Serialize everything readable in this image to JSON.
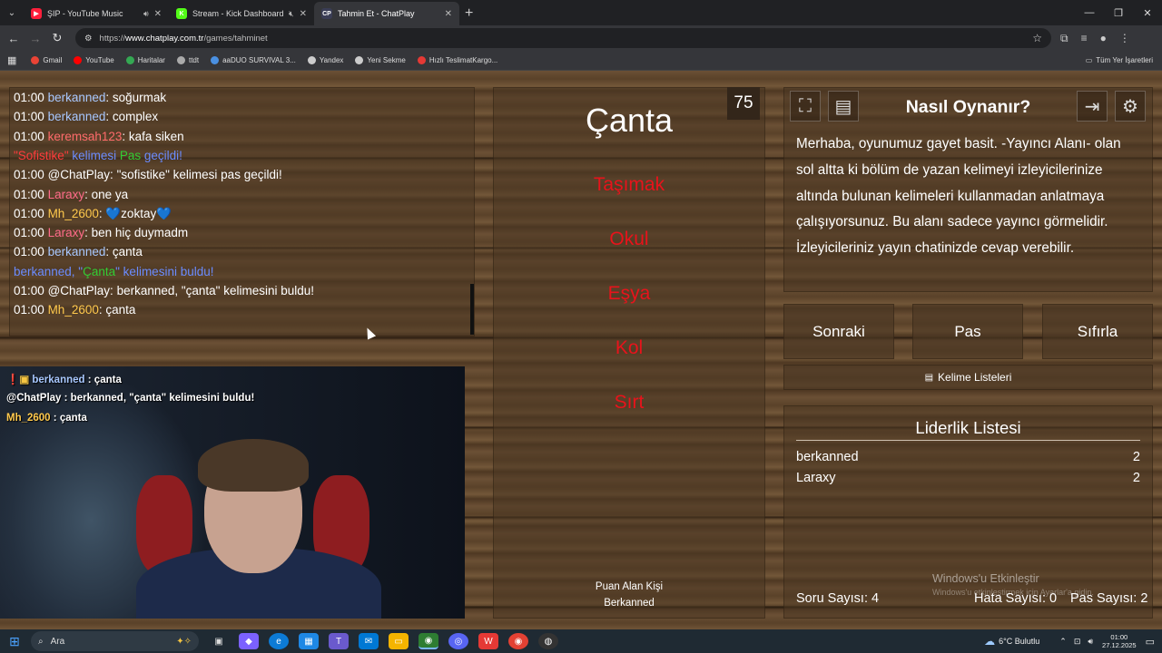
{
  "tabs": [
    {
      "title": "ŞIP - YouTube Music",
      "favicon_color": "#ff1f3b",
      "favicon_glyph": "▶",
      "audio": "speaker-icon"
    },
    {
      "title": "Stream - Kick Dashboard",
      "favicon_color": "#53fc18",
      "favicon_glyph": "K",
      "audio": "muted-speaker-icon"
    },
    {
      "title": "Tahmin Et - ChatPlay",
      "favicon_color": "#3a3d55",
      "favicon_glyph": "CP",
      "active": true
    }
  ],
  "address": {
    "prefix": "https://",
    "host": "www.chatplay.com.tr",
    "path": "/games/tahminet"
  },
  "bookmarks": [
    {
      "label": "Gmail",
      "color": "#ea4335"
    },
    {
      "label": "YouTube",
      "color": "#ff0000"
    },
    {
      "label": "Haritalar",
      "color": "#34a853"
    },
    {
      "label": "ttdt",
      "color": "#aaaaaa"
    },
    {
      "label": "aaDUO SURVIVAL 3...",
      "color": "#4a90e2"
    },
    {
      "label": "Yandex",
      "color": "#cccccc"
    },
    {
      "label": "Yeni Sekme",
      "color": "#cccccc"
    },
    {
      "label": "Hızlı TeslimatKargo...",
      "color": "#e53935"
    }
  ],
  "bookmarks_right": "Tüm Yer İşaretleri",
  "chat": [
    {
      "time": "01:00",
      "user": "berkanned",
      "user_color": "#a8c8ff",
      "msg": "soğurmak"
    },
    {
      "time": "01:00",
      "user": "berkanned",
      "user_color": "#a8c8ff",
      "msg": "complex"
    },
    {
      "time": "01:00",
      "user": "keremsah123",
      "user_color": "#ff6b6b",
      "msg": "kafa siken"
    },
    {
      "time": "",
      "user": "\"Sofistike\"",
      "user_color": "#ff3b3b",
      "msg": "",
      "parts": [
        {
          "t": "\"Sofistike\" ",
          "c": "#ff3b3b"
        },
        {
          "t": "kelimesi ",
          "c": "#6b8cff"
        },
        {
          "t": "Pas ",
          "c": "#33cc33"
        },
        {
          "t": "geçildi!",
          "c": "#6b8cff"
        }
      ]
    },
    {
      "time": "01:00",
      "user": "@ChatPlay",
      "user_color": "#ffffff",
      "msg": "\"sofistike\" kelimesi pas geçildi!"
    },
    {
      "time": "01:00",
      "user": "Laraxy",
      "user_color": "#ff6b8a",
      "msg": "one ya"
    },
    {
      "time": "01:00",
      "user": "Mh_2600",
      "user_color": "#ffc94d",
      "msg": "💙zoktay💙"
    },
    {
      "time": "01:00",
      "user": "Laraxy",
      "user_color": "#ff6b8a",
      "msg": "ben hiç duymadm"
    },
    {
      "time": "01:00",
      "user": "berkanned",
      "user_color": "#a8c8ff",
      "msg": "çanta"
    },
    {
      "time": "",
      "user": "",
      "user_color": "#6b8cff",
      "msg": "",
      "parts": [
        {
          "t": "berkanned, \"",
          "c": "#6b8cff"
        },
        {
          "t": "Çanta",
          "c": "#33cc33"
        },
        {
          "t": "\" kelimesini buldu!",
          "c": "#6b8cff"
        }
      ]
    },
    {
      "time": "01:00",
      "user": "@ChatPlay",
      "user_color": "#ffffff",
      "msg": "berkanned, \"çanta\" kelimesini buldu!"
    },
    {
      "time": "01:00",
      "user": "Mh_2600",
      "user_color": "#ffc94d",
      "msg": "çanta"
    }
  ],
  "cam_overlay": [
    {
      "user": "berkanned",
      "user_color": "#a8c8ff",
      "sep": " : ",
      "msg": "çanta",
      "badges": true
    },
    {
      "user": "@ChatPlay",
      "user_color": "#ffffff",
      "sep": " : ",
      "msg": "berkanned, \"çanta\" kelimesini buldu!"
    },
    {
      "user": "Mh_2600",
      "user_color": "#ffc94d",
      "sep": " : ",
      "msg": "çanta"
    }
  ],
  "game": {
    "timer": "75",
    "word": "Çanta",
    "taboo": [
      "Taşımak",
      "Okul",
      "Eşya",
      "Kol",
      "Sırt"
    ],
    "scorer_label": "Puan Alan Kişi",
    "scorer_name": "Berkanned"
  },
  "howto": {
    "title": "Nasıl Oynanır?",
    "text": "Merhaba, oyunumuz gayet basit. -Yayıncı Alanı- olan sol altta ki bölüm de yazan kelimeyi izleyicilerinize altında bulunan kelimeleri kullanmadan anlatmaya çalışıyorsunuz. Bu alanı sadece yayıncı görmelidir. İzleyicileriniz yayın chatinizde cevap verebilir."
  },
  "buttons": {
    "next": "Sonraki",
    "pass": "Pas",
    "reset": "Sıfırla",
    "word_lists": "Kelime Listeleri"
  },
  "leaderboard": {
    "title": "Liderlik Listesi",
    "rows": [
      {
        "name": "berkanned",
        "score": "2"
      },
      {
        "name": "Laraxy",
        "score": "2"
      }
    ]
  },
  "stats": {
    "questions": "Soru Sayısı: 4",
    "errors": "Hata Sayısı: 0",
    "passes": "Pas Sayısı: 2"
  },
  "watermark": {
    "title": "Windows'u Etkinleştir",
    "sub": "Windows'u etkinleştirmek için Ayarlar'a gidin."
  },
  "taskbar": {
    "search": "Ara",
    "weather": "6°C  Bulutlu",
    "time": "01:00",
    "date": "27.12.2025"
  }
}
